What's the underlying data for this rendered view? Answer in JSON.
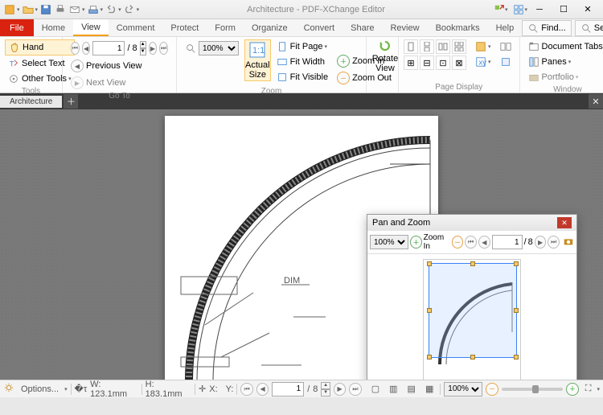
{
  "title": "Architecture - PDF-XChange Editor",
  "menu": {
    "file": "File",
    "tabs": [
      "Home",
      "View",
      "Comment",
      "Protect",
      "Form",
      "Organize",
      "Convert",
      "Share",
      "Review",
      "Bookmarks",
      "Help"
    ],
    "active_index": 1,
    "find": "Find...",
    "search": "Search..."
  },
  "ribbon": {
    "tools": {
      "hand": "Hand",
      "select": "Select Text",
      "other": "Other Tools",
      "label": "Tools"
    },
    "goto": {
      "page_current": "1",
      "page_sep": "/",
      "page_total": "8",
      "prev": "Previous View",
      "next": "Next View",
      "label": "Go To"
    },
    "zoom": {
      "level": "100%",
      "actual": "Actual Size",
      "fit_page": "Fit Page",
      "fit_width": "Fit Width",
      "fit_visible": "Fit Visible",
      "zoom_in": "Zoom In",
      "zoom_out": "Zoom Out",
      "rotate": "Rotate View",
      "label": "Zoom"
    },
    "page_display": {
      "label": "Page Display"
    },
    "window": {
      "doc_tabs": "Document Tabs",
      "panes": "Panes",
      "portfolio": "Portfolio",
      "label": "Window"
    }
  },
  "doc_tab": "Architecture",
  "panzoom": {
    "title": "Pan and Zoom",
    "zoom": "100%",
    "zoom_in": "Zoom In",
    "page_current": "1",
    "page_sep": "/",
    "page_total": "8"
  },
  "status": {
    "options": "Options...",
    "w": "W: 123.1mm",
    "h": "H: 183.1mm",
    "x": "X:",
    "y": "Y:",
    "page_current": "1",
    "page_sep": "/",
    "page_total": "8",
    "zoom": "100%"
  }
}
